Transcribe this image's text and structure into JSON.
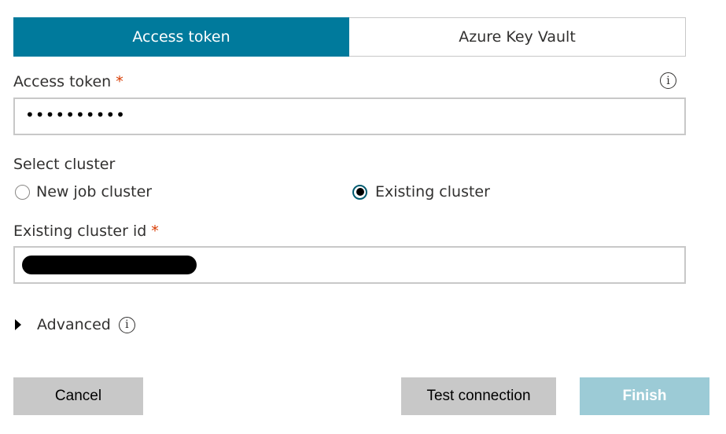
{
  "tabs": [
    {
      "label": "Access token",
      "active": true
    },
    {
      "label": "Azure Key Vault",
      "active": false
    }
  ],
  "access_token": {
    "label": "Access token",
    "required_marker": "*",
    "value": "••••••••••"
  },
  "select_cluster": {
    "label": "Select cluster",
    "options": [
      {
        "label": "New job cluster",
        "checked": false
      },
      {
        "label": "Existing cluster",
        "checked": true
      }
    ]
  },
  "existing_cluster_id": {
    "label": "Existing cluster id",
    "required_marker": "*"
  },
  "advanced": {
    "label": "Advanced"
  },
  "buttons": {
    "cancel": "Cancel",
    "test_connection": "Test connection",
    "finish": "Finish"
  },
  "colors": {
    "accent": "#007a9c",
    "required": "#d83b01",
    "button_gray": "#c8c8c8",
    "button_disabled": "#9ccbd6",
    "border": "#c8c8c8"
  },
  "icons": {
    "info": "info-icon",
    "expand": "caret-right-icon",
    "radio_checked": "radio-checked-icon",
    "radio_unchecked": "radio-unchecked-icon"
  }
}
